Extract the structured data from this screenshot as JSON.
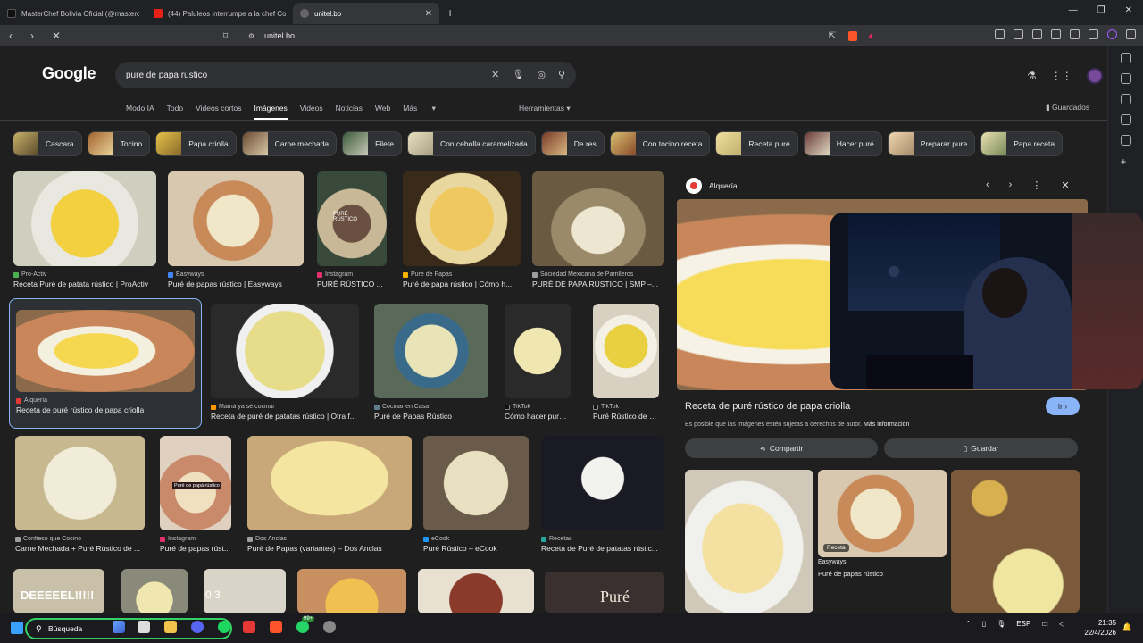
{
  "browser": {
    "tabs": [
      {
        "title": "MasterChef Bolivia Oficial (@masterc",
        "color": "#111111"
      },
      {
        "title": "(44) Paluleos interrumpe a la chef Co",
        "color": "#e62117"
      },
      {
        "title": "unitel.bo",
        "color": "#666666"
      }
    ],
    "url": "unitel.bo"
  },
  "google": {
    "logo": "Google",
    "query": "pure de papa rustico",
    "nav": [
      "Modo IA",
      "Todo",
      "Videos cortos",
      "Imágenes",
      "Videos",
      "Noticias",
      "Web",
      "Más"
    ],
    "tools": "Herramientas",
    "saved": "Guardados",
    "chips": [
      "Cascara",
      "Tocino",
      "Papa criolla",
      "Carne mechada",
      "Filete",
      "Con cebolla caramelizada",
      "De res",
      "Con tocino receta",
      "Receta puré",
      "Hacer puré",
      "Preparar pure",
      "Papa receta"
    ]
  },
  "results": [
    {
      "source": "Pro-Activ",
      "title": "Receta Puré de patata rústico | ProActiv"
    },
    {
      "source": "Easyways",
      "title": "Puré de papas rústico | Easyways"
    },
    {
      "source": "Instagram",
      "title": "PURÉ RÚSTICO ..."
    },
    {
      "source": "Pure de Papas",
      "title": "Puré de papa rústico | Cómo h..."
    },
    {
      "source": "Sociedad Mexicana de Parrilleros",
      "title": "PURÉ DE PAPA RÚSTICO | SMP –..."
    },
    {
      "source": "Alquería",
      "title": "Receta de puré rústico de papa criolla"
    },
    {
      "source": "Mamá ya sé cocinar",
      "title": "Receta de puré de patatas rústico | Otra f..."
    },
    {
      "source": "Cocinar en Casa",
      "title": "Puré de Papas Rústico"
    },
    {
      "source": "TikTok",
      "title": "Cómo hacer puré ..."
    },
    {
      "source": "TikTok",
      "title": "Puré Rústico de P..."
    },
    {
      "source": "Confieso que Cocino",
      "title": "Carne Mechada + Puré Rústico de ..."
    },
    {
      "source": "Instagram",
      "title": "Puré de papas rúst..."
    },
    {
      "source": "Dos Anclas",
      "title": "Puré de Papas (variantes) – Dos Anclas"
    },
    {
      "source": "eCook",
      "title": "Puré Rústico – eCook"
    },
    {
      "source": "Recetas",
      "title": "Receta de Puré de patatas rústic..."
    }
  ],
  "overlay_text": {
    "img3": "PURÉ\nRÚSTICO",
    "img12": "Puré de papá rústico",
    "row4a": "DEEEEEL!!!!!",
    "row4b": "0 3",
    "row4c": "Puré"
  },
  "panel": {
    "source": "Alquería",
    "title": "Receta de puré rústico de papa criolla",
    "go": "Ir",
    "note": "Es posible que las imágenes estén sujetas a derechos de autor.",
    "more": "Más información",
    "share": "Compartir",
    "save": "Guardar",
    "related_badge": "Receta",
    "related_source": "Easyways",
    "related_title": "Puré de papas rústico"
  },
  "taskbar": {
    "search": "Búsqueda",
    "lang": "ESP",
    "time": "21:35",
    "date": "22/4/2026",
    "badge": "99+"
  }
}
